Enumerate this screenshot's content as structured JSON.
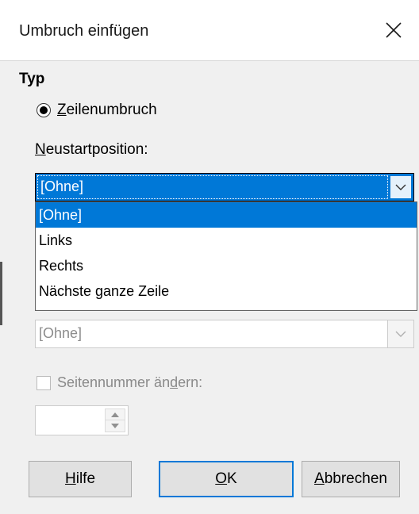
{
  "dialog": {
    "title": "Umbruch einfügen"
  },
  "type_section": {
    "label": "Typ",
    "radio_label": "Zeilenumbruch",
    "radio_label_mnemonic": "Z",
    "radio_label_rest": "eilenumbruch"
  },
  "restart": {
    "label_mnemonic": "N",
    "label_rest": "eustartposition:",
    "selected": "[Ohne]",
    "options": [
      "[Ohne]",
      "Links",
      "Rechts",
      "Nächste ganze Zeile"
    ]
  },
  "style_combo": {
    "value": "[Ohne]"
  },
  "page_number": {
    "label_pre": "Seitennummer än",
    "label_mnemonic": "d",
    "label_post": "ern:",
    "value": ""
  },
  "buttons": {
    "help_mnemonic": "H",
    "help_rest": "ilfe",
    "ok_mnemonic": "O",
    "ok_rest": "K",
    "cancel_mnemonic": "A",
    "cancel_rest": "bbrechen"
  },
  "colors": {
    "accent": "#0078d7",
    "disabled_text": "#8a8a8a"
  }
}
